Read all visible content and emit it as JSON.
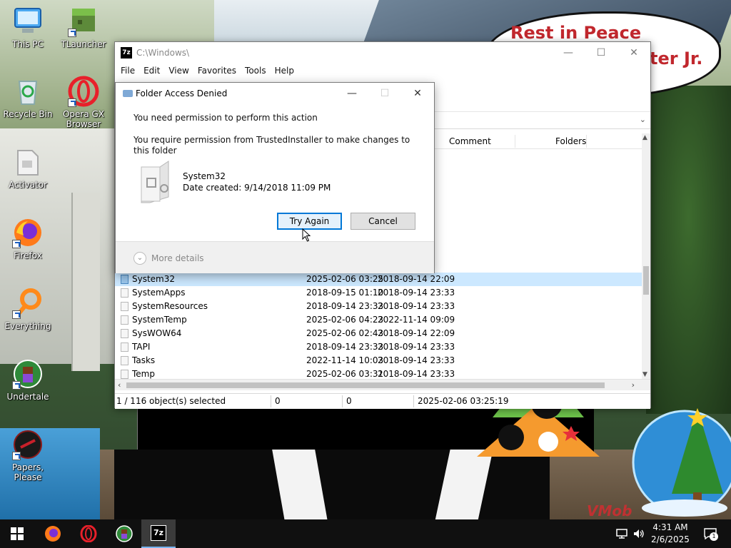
{
  "wallpaper": {
    "bubble_line1": "Rest in Peace",
    "bubble_line2": "ter Jr.",
    "watermark": "VMob"
  },
  "desktop": {
    "icons": [
      {
        "label": "This PC",
        "icon": "this-pc-icon"
      },
      {
        "label": "TLauncher",
        "icon": "tlauncher-icon"
      },
      {
        "label": "Recycle Bin",
        "icon": "recycle-bin-icon"
      },
      {
        "label": "Opera GX Browser",
        "icon": "opera-gx-icon"
      },
      {
        "label": "Activator",
        "icon": "activator-icon"
      },
      {
        "label": "Firefox",
        "icon": "firefox-icon"
      },
      {
        "label": "Everything",
        "icon": "everything-icon"
      },
      {
        "label": "Undertale",
        "icon": "undertale-icon"
      },
      {
        "label": "Papers, Please",
        "icon": "papers-please-icon"
      }
    ]
  },
  "explorer": {
    "app_icon": "7z",
    "title": "C:\\Windows\\",
    "menu": [
      "File",
      "Edit",
      "View",
      "Favorites",
      "Tools",
      "Help"
    ],
    "columns": {
      "comment": "Comment",
      "folders": "Folders"
    },
    "hidden_row_suffixes": [
      "6",
      "3",
      "3",
      "3",
      "0",
      "3",
      "3",
      "1",
      "3"
    ],
    "rows": [
      {
        "name": "System32",
        "modified": "2025-02-06 03:25",
        "created": "2018-09-14 22:09",
        "selected": true
      },
      {
        "name": "SystemApps",
        "modified": "2018-09-15 01:10",
        "created": "2018-09-14 23:33"
      },
      {
        "name": "SystemResources",
        "modified": "2018-09-14 23:33",
        "created": "2018-09-14 23:33"
      },
      {
        "name": "SystemTemp",
        "modified": "2025-02-06 04:23",
        "created": "2022-11-14 09:09"
      },
      {
        "name": "SysWOW64",
        "modified": "2025-02-06 02:43",
        "created": "2018-09-14 22:09"
      },
      {
        "name": "TAPI",
        "modified": "2018-09-14 23:33",
        "created": "2018-09-14 23:33"
      },
      {
        "name": "Tasks",
        "modified": "2022-11-14 10:03",
        "created": "2018-09-14 23:33"
      },
      {
        "name": "Temp",
        "modified": "2025-02-06 03:31",
        "created": "2018-09-14 23:33"
      }
    ],
    "status": {
      "selection": "1 / 116 object(s) selected",
      "size": "0",
      "packed": "0",
      "modified": "2025-02-06 03:25:19"
    }
  },
  "dialog": {
    "title": "Folder Access Denied",
    "message1": "You need permission to perform this action",
    "message2": "You require permission from TrustedInstaller to make changes to this folder",
    "folder_name": "System32",
    "date_created": "Date created: 9/14/2018 11:09 PM",
    "try_again": "Try Again",
    "cancel": "Cancel",
    "more_details": "More details"
  },
  "taskbar": {
    "pinned": [
      "start-icon",
      "firefox-icon",
      "opera-icon",
      "undertale-icon",
      "7zip-icon"
    ],
    "clock_time": "4:31 AM",
    "clock_date": "2/6/2025",
    "notification_count": "1",
    "sevenzip_label": "7z"
  },
  "colors": {
    "accent": "#0078d7",
    "selection": "#cce8ff",
    "taskbar": "#101010"
  }
}
